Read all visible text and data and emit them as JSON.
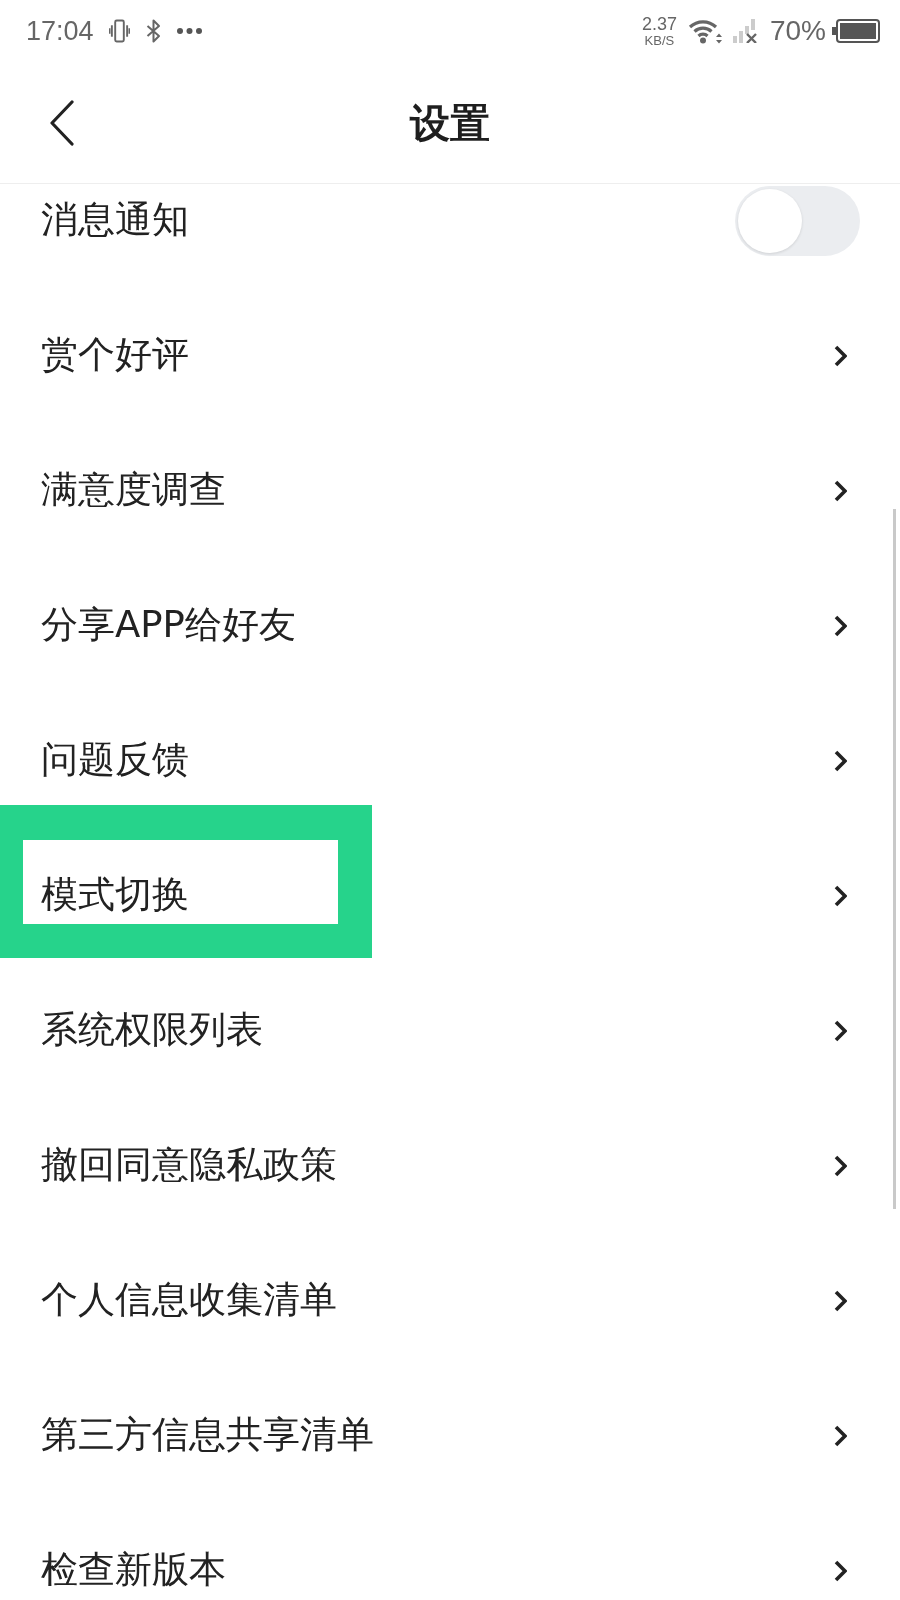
{
  "status_bar": {
    "time": "17:04",
    "network_speed": {
      "value": "2.37",
      "unit": "KB/S"
    },
    "battery": "70%"
  },
  "header": {
    "title": "设置"
  },
  "settings": [
    {
      "kind": "toggle",
      "label": "消息通知",
      "on": false,
      "highlighted": false
    },
    {
      "kind": "link",
      "label": "赏个好评",
      "highlighted": false
    },
    {
      "kind": "link",
      "label": "满意度调查",
      "highlighted": false
    },
    {
      "kind": "link",
      "label": "分享APP给好友",
      "highlighted": false
    },
    {
      "kind": "link",
      "label": "问题反馈",
      "highlighted": false
    },
    {
      "kind": "link",
      "label": "模式切换",
      "highlighted": true
    },
    {
      "kind": "link",
      "label": "系统权限列表",
      "highlighted": false
    },
    {
      "kind": "link",
      "label": "撤回同意隐私政策",
      "highlighted": false
    },
    {
      "kind": "link",
      "label": "个人信息收集清单",
      "highlighted": false
    },
    {
      "kind": "link",
      "label": "第三方信息共享清单",
      "highlighted": false
    },
    {
      "kind": "link",
      "label": "检查新版本",
      "highlighted": false
    }
  ]
}
